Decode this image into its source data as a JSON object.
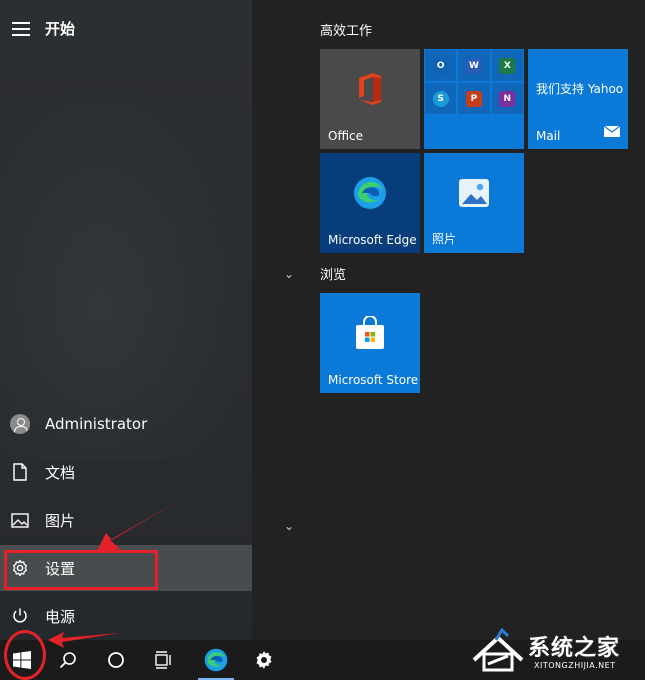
{
  "start_menu": {
    "title": "开始",
    "left_items": [
      {
        "label": "Administrator"
      },
      {
        "label": "文档"
      },
      {
        "label": "图片"
      },
      {
        "label": "设置"
      },
      {
        "label": "电源"
      }
    ]
  },
  "tile_groups": [
    {
      "title": "高效工作"
    },
    {
      "title": "浏览"
    }
  ],
  "tiles": {
    "office": {
      "label": "Office"
    },
    "office_apps": {
      "apps": [
        "O",
        "W",
        "X",
        "S",
        "P",
        "N"
      ]
    },
    "mail": {
      "text": "我们支持 Yahoo",
      "label": "Mail"
    },
    "edge": {
      "label": "Microsoft Edge"
    },
    "photos": {
      "label": "照片"
    },
    "store": {
      "label": "Microsoft Store"
    }
  },
  "watermark": {
    "name": "系统之家",
    "url": "XITONGZHIJIA.NET"
  },
  "colors": {
    "accent": "#0a79d8",
    "annotation": "#e5222a",
    "taskbar": "#1b1b1b"
  }
}
